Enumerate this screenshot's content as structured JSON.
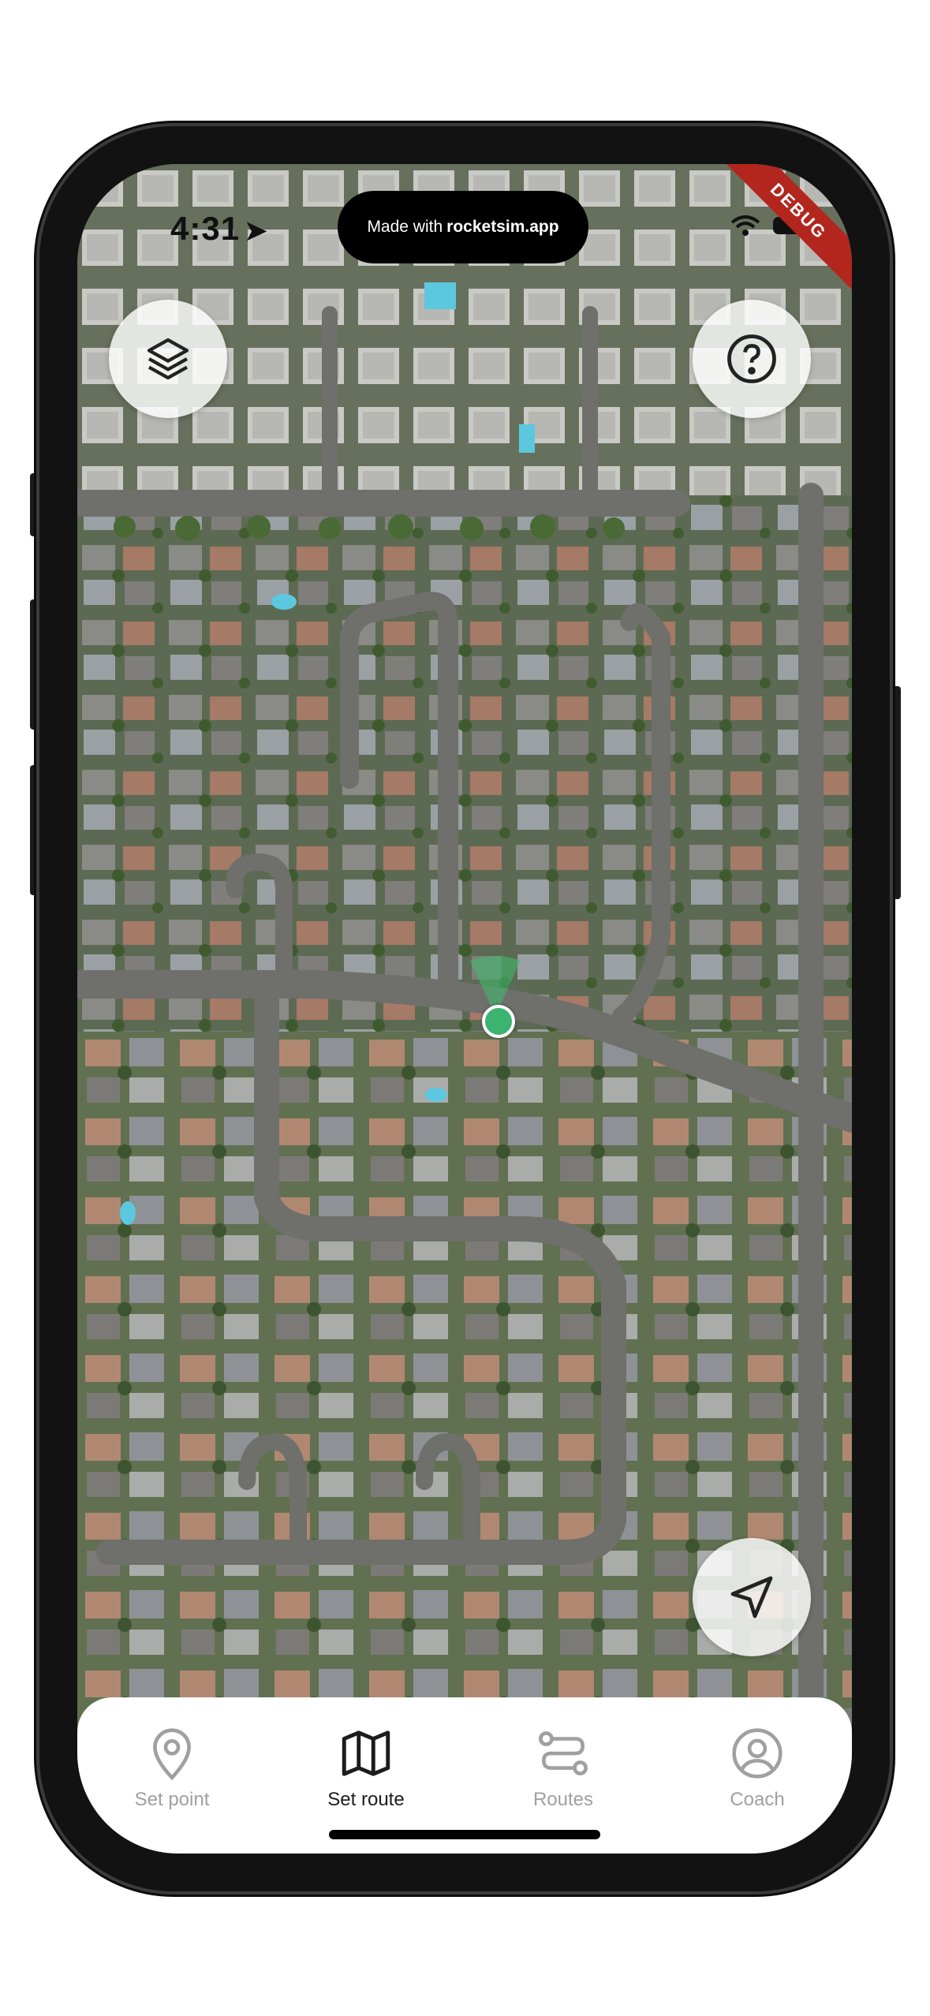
{
  "status_bar": {
    "time": "4:31",
    "island_prefix": "Made with",
    "island_brand": "rocketsim.app",
    "debug_label": "DEBUG"
  },
  "map": {
    "type": "satellite"
  },
  "buttons": {
    "layers_icon": "layers-icon",
    "help_icon": "help-icon",
    "locate_icon": "navigation-arrow-icon"
  },
  "nav": {
    "tabs": [
      {
        "label": "Set point",
        "icon": "map-pin-icon",
        "active": false
      },
      {
        "label": "Set route",
        "icon": "map-icon",
        "active": true
      },
      {
        "label": "Routes",
        "icon": "route-icon",
        "active": false
      },
      {
        "label": "Coach",
        "icon": "user-circle-icon",
        "active": false
      }
    ]
  },
  "colors": {
    "active_tab": "#1c1c1c",
    "inactive_tab": "#a0a0a0",
    "location": "#3bb371",
    "debug": "#b3261e"
  }
}
